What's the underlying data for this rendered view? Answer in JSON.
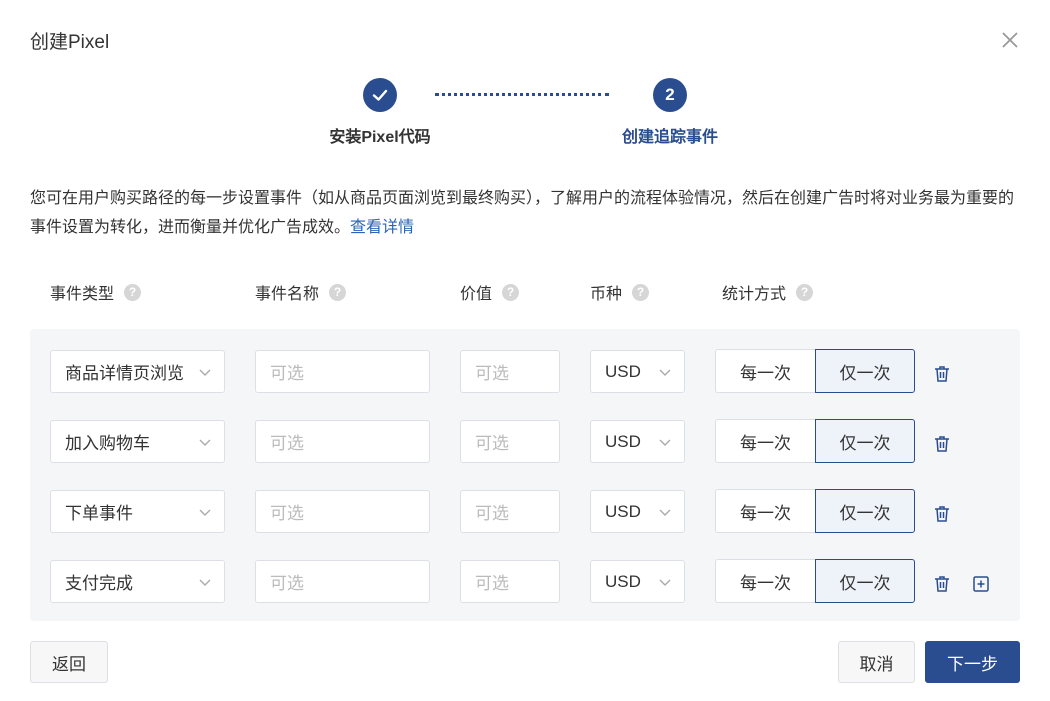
{
  "dialog": {
    "title": "创建Pixel"
  },
  "steps": [
    {
      "label": "安装Pixel代码",
      "state": "done",
      "icon": "check-icon"
    },
    {
      "label": "创建追踪事件",
      "number": "2",
      "state": "active"
    }
  ],
  "description": {
    "text": "您可在用户购买路径的每一步设置事件（如从商品页面浏览到最终购买），了解用户的流程体验情况，然后在创建广告时将对业务最为重要的事件设置为转化，进而衡量并优化广告成效。",
    "link": "查看详情"
  },
  "columns": {
    "event_type": "事件类型",
    "event_name": "事件名称",
    "value": "价值",
    "currency": "币种",
    "count_method": "统计方式"
  },
  "help_glyph": "?",
  "rows": [
    {
      "event_type": "商品详情页浏览",
      "name_placeholder": "可选",
      "value_placeholder": "可选",
      "currency": "USD",
      "count_every": "每一次",
      "count_once": "仅一次"
    },
    {
      "event_type": "加入购物车",
      "name_placeholder": "可选",
      "value_placeholder": "可选",
      "currency": "USD",
      "count_every": "每一次",
      "count_once": "仅一次"
    },
    {
      "event_type": "下单事件",
      "name_placeholder": "可选",
      "value_placeholder": "可选",
      "currency": "USD",
      "count_every": "每一次",
      "count_once": "仅一次"
    },
    {
      "event_type": "支付完成",
      "name_placeholder": "可选",
      "value_placeholder": "可选",
      "currency": "USD",
      "count_every": "每一次",
      "count_once": "仅一次"
    }
  ],
  "footer": {
    "back": "返回",
    "cancel": "取消",
    "next": "下一步"
  },
  "colors": {
    "primary": "#2a4d8f",
    "link": "#2a63b8",
    "row_bg": "#f5f6f8",
    "selected_bg": "#eef3f9"
  }
}
